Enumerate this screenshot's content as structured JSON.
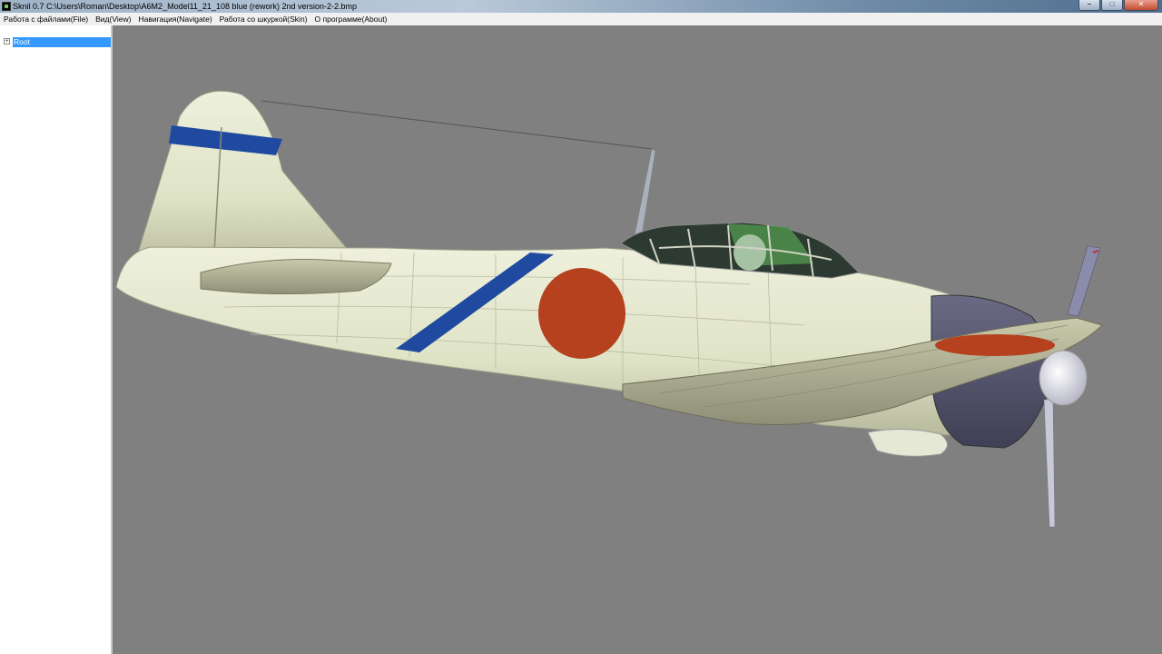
{
  "window": {
    "title": "Sknil 0.7   C:\\Users\\Roman\\Desktop\\A6M2_Model11_21_108 blue (rework) 2nd version-2-2.bmp",
    "controls": {
      "minimize": "–",
      "maximize": "□",
      "close": "✕"
    }
  },
  "menu": {
    "items": [
      "Работа с файлами(File)",
      "Вид(View)",
      "Навигация(Navigate)",
      "Работа со шкуркой(Skin)",
      "О программе(About)"
    ]
  },
  "tree": {
    "root_label": "Root",
    "expander": "+"
  },
  "viewport": {
    "background": "#808080",
    "model": "A6M2 Zero aircraft 3D model",
    "colors": {
      "airframe": "#dfe3c6",
      "wing": "#b9b99a",
      "tail_band": "#1f4aa0",
      "hinomaru": "#b5411f",
      "cowling": "#50506a",
      "canopy": "#4c8c4a"
    }
  }
}
